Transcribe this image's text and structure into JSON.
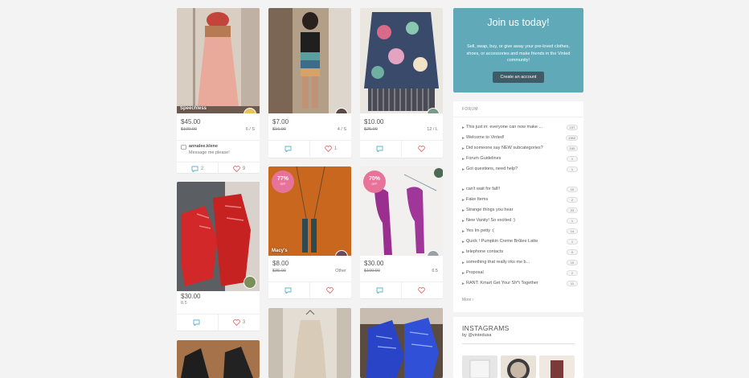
{
  "colors": {
    "accent": "#5fa9b9",
    "badge": "#e8739a",
    "button": "#3f5c66",
    "comment": "#5bb3d0",
    "like": "#e07070"
  },
  "cards": [
    {
      "brand": "Speechless",
      "price": "$45.00",
      "old_price": "$100.00",
      "size": "6 / S",
      "comment_user": "annalee.klene",
      "comment_text": "Message me please!",
      "comments": "2",
      "likes": "9"
    },
    {
      "price": "$7.00",
      "old_price": "$16.00",
      "size": "4 / S",
      "comments": "",
      "likes": "1"
    },
    {
      "price": "$10.00",
      "old_price": "$25.00",
      "size": "12 / L",
      "comments": "",
      "likes": ""
    },
    {
      "price": "$30.00",
      "size": "8.5",
      "comments": "",
      "likes": "3"
    },
    {
      "brand": "Macy's",
      "badge_pct": "77%",
      "badge_off": "OFF",
      "price": "$8.00",
      "old_price": "$35.00",
      "size": "Other",
      "comments": "",
      "likes": ""
    },
    {
      "badge_pct": "70%",
      "badge_off": "OFF",
      "price": "$30.00",
      "old_price": "$100.00",
      "size": "6.5",
      "comments": "",
      "likes": ""
    }
  ],
  "join": {
    "title": "Join us today!",
    "description": "Sell, swap, buy, or give away your pre-loved clothes, shoes, or accessories and make friends in the Vinted community!",
    "button": "Create an account"
  },
  "forum": {
    "header": "FORUM",
    "topics": [
      {
        "title": "This just in: everyone can now make ...",
        "count": "107"
      },
      {
        "title": "Welcome to Vinted!",
        "count": "1352"
      },
      {
        "title": "Did someone say NEW subcategories?",
        "count": "100"
      },
      {
        "title": "Forum Guidelines",
        "count": "1"
      },
      {
        "title": "Got questions, need help?",
        "count": "1"
      },
      {
        "title": "can't wait for fall!!",
        "count": "10"
      },
      {
        "title": "Fake Items",
        "count": "2"
      },
      {
        "title": "Strange things you hear",
        "count": "23"
      },
      {
        "title": "New Vanity! So excited :)",
        "count": "1"
      },
      {
        "title": "Yes Im petty :(",
        "count": "14"
      },
      {
        "title": "Quick ! Pumpkin Creme Brûlee Latte",
        "count": "1"
      },
      {
        "title": "telephone contacts",
        "count": "9"
      },
      {
        "title": "something that really irks me b...",
        "count": "10"
      },
      {
        "title": "Proposal",
        "count": "2"
      },
      {
        "title": "RANT: Kmart Get Your Sh*t Together",
        "count": "11"
      }
    ],
    "more": "More"
  },
  "instagram": {
    "title": "INSTAGRAMS",
    "by": "by @vintedusa"
  }
}
